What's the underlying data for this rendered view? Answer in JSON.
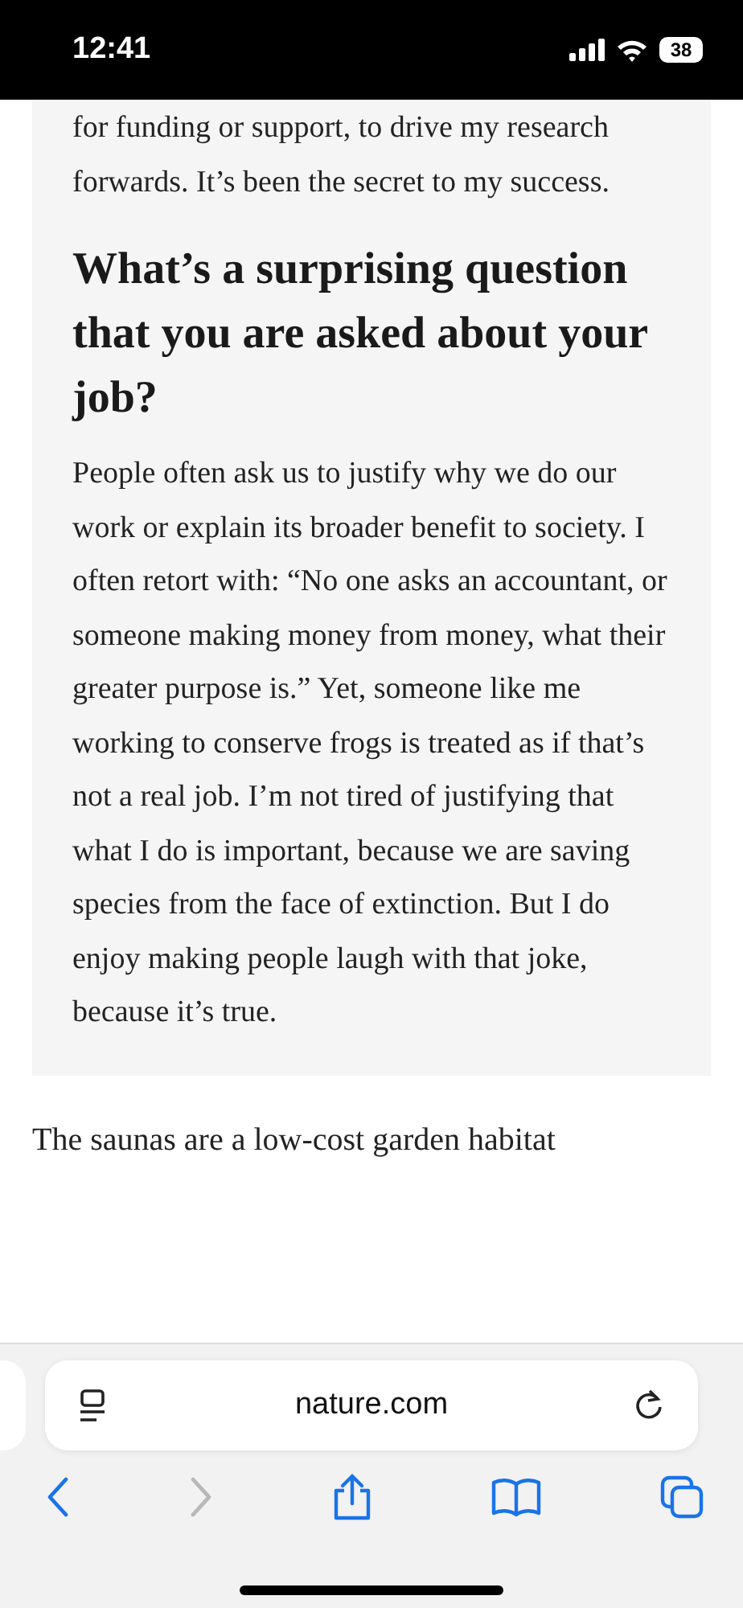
{
  "status_bar": {
    "time": "12:41",
    "battery": "38"
  },
  "article": {
    "box": {
      "paragraph_start": "for funding or support, to drive my research forwards. It’s been the secret to my success.",
      "heading": "What’s a surprising question that you are asked about your job?",
      "paragraph": "People often ask us to justify why we do our work or explain its broader benefit to society. I often retort with: “No one asks an accountant, or someone making money from money, what their greater purpose is.” Yet, someone like me working to conserve frogs is treated as if that’s not a real job. I’m not tired of justifying that what I do is important, because we are saving species from the face of extinction. But I do enjoy making people laugh with that joke, because it’s true."
    },
    "paragraph": "The saunas are a low-cost garden habitat"
  },
  "browser": {
    "address": "nature.com",
    "back": {
      "disabled": false
    },
    "forward": {
      "disabled": true
    }
  }
}
